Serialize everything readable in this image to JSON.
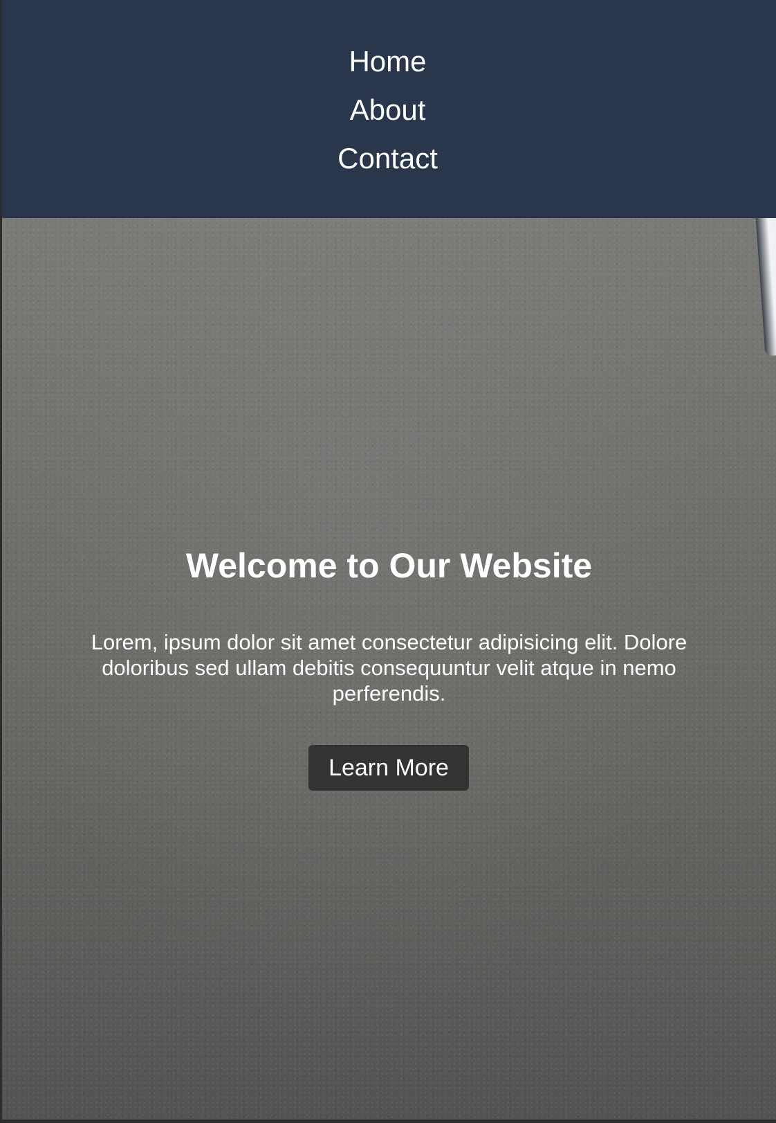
{
  "nav": {
    "items": [
      {
        "label": "Home"
      },
      {
        "label": "About"
      },
      {
        "label": "Contact"
      }
    ]
  },
  "hero": {
    "title": "Welcome to Our Website",
    "text": "Lorem, ipsum dolor sit amet consectetur adipisicing elit. Dolore doloribus sed ullam debitis consequuntur velit atque in nemo perferendis.",
    "button_label": "Learn More"
  },
  "colors": {
    "navbar_bg": "#29364b",
    "button_bg": "#333333",
    "text": "#ffffff"
  }
}
